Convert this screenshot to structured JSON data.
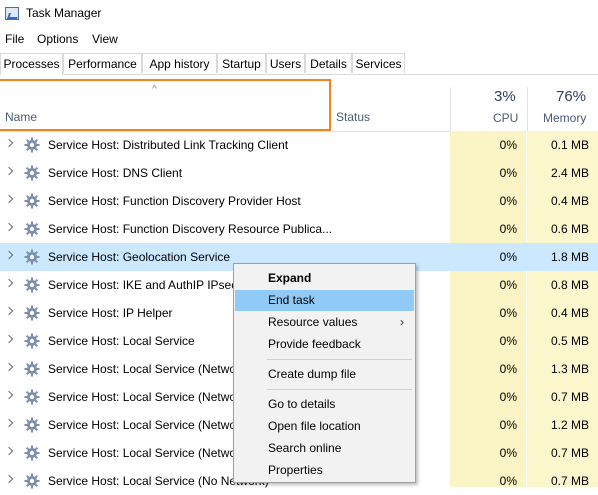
{
  "window": {
    "title": "Task Manager"
  },
  "menu": {
    "items": [
      "File",
      "Options",
      "View"
    ]
  },
  "tabs": [
    "Processes",
    "Performance",
    "App history",
    "Startup",
    "Users",
    "Details",
    "Services"
  ],
  "active_tab": "Processes",
  "columns": {
    "name": "Name",
    "status": "Status",
    "cpu_total": "3%",
    "cpu_label": "CPU",
    "memory_total": "76%",
    "memory_label": "Memory",
    "sort_indicator": "^"
  },
  "rows": [
    {
      "name": "Service Host: Distributed Link Tracking Client",
      "cpu": "0%",
      "memory": "0.1 MB"
    },
    {
      "name": "Service Host: DNS Client",
      "cpu": "0%",
      "memory": "2.4 MB"
    },
    {
      "name": "Service Host: Function Discovery Provider Host",
      "cpu": "0%",
      "memory": "0.4 MB"
    },
    {
      "name": "Service Host: Function Discovery Resource Publica...",
      "cpu": "0%",
      "memory": "0.6 MB"
    },
    {
      "name": "Service Host: Geolocation Service",
      "cpu": "0%",
      "memory": "1.8 MB",
      "selected": true
    },
    {
      "name": "Service Host: IKE and AuthIP IPsec K",
      "cpu": "0%",
      "memory": "0.8 MB"
    },
    {
      "name": "Service Host: IP Helper",
      "cpu": "0%",
      "memory": "0.4 MB"
    },
    {
      "name": "Service Host: Local Service",
      "cpu": "0%",
      "memory": "0.5 MB"
    },
    {
      "name": "Service Host: Local Service (Networ",
      "cpu": "0%",
      "memory": "1.3 MB"
    },
    {
      "name": "Service Host: Local Service (Networ",
      "cpu": "0%",
      "memory": "0.7 MB"
    },
    {
      "name": "Service Host: Local Service (Networ",
      "cpu": "0%",
      "memory": "1.2 MB"
    },
    {
      "name": "Service Host: Local Service (Networ",
      "cpu": "0%",
      "memory": "0.7 MB"
    },
    {
      "name": "Service Host: Local Service (No Network)",
      "cpu": "0%",
      "memory": "0.7 MB"
    }
  ],
  "context_menu": {
    "items": [
      {
        "label": "Expand",
        "bold": true
      },
      {
        "label": "End task",
        "hover": true
      },
      {
        "label": "Resource values",
        "submenu": true
      },
      {
        "label": "Provide feedback"
      },
      {
        "separator": true
      },
      {
        "label": "Create dump file"
      },
      {
        "separator": true
      },
      {
        "label": "Go to details"
      },
      {
        "label": "Open file location"
      },
      {
        "label": "Search online"
      },
      {
        "label": "Properties"
      }
    ]
  },
  "colors": {
    "highlight_border": "#f0841f",
    "selected_row": "#cce8ff",
    "cpu_column": "#fbf4c4",
    "memory_column": "#fcf6cc",
    "menu_hover": "#91c9f7",
    "gear_icon": "#7a8fb0"
  },
  "icons": {
    "row_icon": "gear-icon",
    "expand": "chevron-right-icon",
    "app": "task-manager-icon",
    "submenu": "chevron-right-icon"
  }
}
